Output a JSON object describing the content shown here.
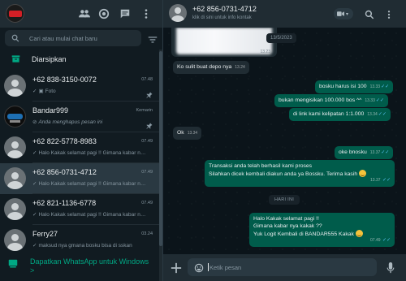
{
  "sidebar": {
    "search_placeholder": "Cari atau mulai chat baru",
    "archived_label": "Diarsipkan",
    "chats": [
      {
        "name": "+62 838-3150-0072",
        "time": "07.48",
        "tick": "✓",
        "preview": "Foto",
        "pinned": true,
        "avatar": "person-avatar"
      },
      {
        "name": "Bandar999",
        "time": "Kemarin",
        "tick": "⊘",
        "preview": "Anda menghapus pesan ini",
        "pinned": true,
        "avatar": "brand-avatar"
      },
      {
        "name": "+62 822-5778-8983",
        "time": "07.49",
        "tick": "✓",
        "preview": "Halo Kakak selamat pagi !! Gimana kabar nya...",
        "pinned": false,
        "avatar": "person-avatar"
      },
      {
        "name": "+62 856-0731-4712",
        "time": "07.49",
        "tick": "✓",
        "preview": "Halo Kakak selamat pagi !! Gimana kabar nya...",
        "pinned": false,
        "avatar": "person-avatar"
      },
      {
        "name": "+62 821-1136-6778",
        "time": "07.49",
        "tick": "✓",
        "preview": "Halo Kakak selamat pagi !! Gimana kabar nya...",
        "pinned": false,
        "avatar": "person-avatar"
      },
      {
        "name": "Ferry27",
        "time": "03.24",
        "tick": "✓",
        "preview": "maksud nya gmana bosku bisa di sskan",
        "pinned": false,
        "avatar": "person-avatar"
      }
    ],
    "download_banner": "Dapatkan WhatsApp untuk Windows >"
  },
  "chat": {
    "contact_name": "+62 856-0731-4712",
    "contact_subtitle": "klik di sini untuk info kontak",
    "image_time": "13.23",
    "date_chip_1": "13/5/2023",
    "date_chip_2": "HARI INI",
    "messages": [
      {
        "dir": "in",
        "text": "Ko sulit buat depo nya",
        "time": "13.24"
      },
      {
        "dir": "out",
        "text": "bosku harus isi 100",
        "time": "13.33"
      },
      {
        "dir": "out",
        "text": "bukan mengisikan 100.000 bos ^^",
        "time": "13.33"
      },
      {
        "dir": "out",
        "text": "di link kami kelipatan 1:1.000",
        "time": "13.34"
      },
      {
        "dir": "in",
        "text": "Ok",
        "time": "13.34"
      },
      {
        "dir": "out",
        "text": "oke bnosku",
        "time": "13.37"
      },
      {
        "dir": "out",
        "text_line1": "Transaksi anda telah berhasil kami proses",
        "text_line2": "Silahkan dicek kembali diakun anda ya Bossku. Terima kasih",
        "time": "13.37"
      },
      {
        "dir": "out",
        "text_line1": "Halo Kakak selamat pagi !!",
        "text_line2": "Gimana kabar nya kakak ??",
        "text_line3": "Yuk Logit Kembali di BANDAR555 Kakak",
        "time": "07.49"
      }
    ],
    "composer_placeholder": "Ketik pesan"
  },
  "colors": {
    "accent": "#00a884",
    "outgoing_bubble": "#005c4b",
    "incoming_bubble": "#202c33",
    "read_ticks": "#53bdeb"
  }
}
